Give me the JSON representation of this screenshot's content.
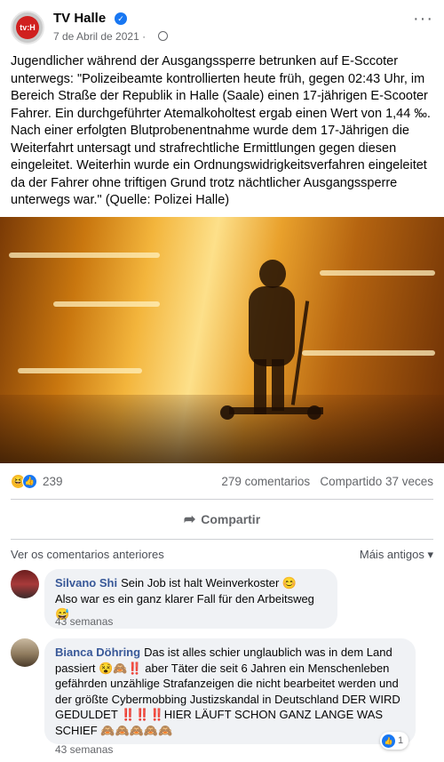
{
  "post": {
    "page_name": "TV Halle",
    "avatar_text": "tv:H",
    "date": "7 de Abril de 2021 ·",
    "text": "Jugendlicher während der Ausgangssperre betrunken auf E-Sccoter unterwegs: \"Polizeibeamte kontrollierten heute früh, gegen 02:43 Uhr, im Bereich Straße der Republik in Halle (Saale) einen 17-jährigen E-Scooter Fahrer. Ein durchgeführter Atemalkoholtest ergab einen Wert von 1,44 ‰. Nach einer erfolgten Blutprobenentnahme wurde dem 17-Jährigen die Weiterfahrt untersagt und strafrechtliche Ermittlungen gegen diesen eingeleitet. Weiterhin wurde ein Ordnungswidrigkeitsverfahren eingeleitet da der Fahrer ohne triftigen Grund trotz nächtlicher Ausgangssperre unterwegs war.\" (Quelle: Polizei Halle)",
    "more_label": "···"
  },
  "stats": {
    "reaction_count": "239",
    "comments": "279 comentarios",
    "shares": "Compartido 37 veces"
  },
  "actions": {
    "share_label": "Compartir"
  },
  "comments_bar": {
    "previous_label": "Ver os comentarios anteriores",
    "sort_label": "Máis antigos ▾"
  },
  "comments": [
    {
      "author": "Silvano Shi",
      "text": "Sein Job ist halt Weinverkoster 😊\nAlso war es ein ganz klarer Fall für den Arbeitsweg 😅",
      "time": "43 semanas"
    },
    {
      "author": "Bianca Döhring",
      "text": "Das ist alles schier unglaublich was in dem Land passiert 😵🙈‼️ aber Täter die seit 6 Jahren ein Menschenleben gefährden unzählige Strafanzeigen die nicht bearbeitet werden und der größte Cybermobbing Justizskandal in Deutschland DER WIRD GEDULDET ‼️‼️‼️HIER LÄUFT SCHON GANZ LANGE WAS SCHIEF 🙈🙈🙈🙈🙈",
      "time": "43 semanas",
      "like_count": "1"
    }
  ],
  "colors": {
    "link": "#385898",
    "like_blue": "#1877f2",
    "bubble": "#f0f2f5"
  }
}
